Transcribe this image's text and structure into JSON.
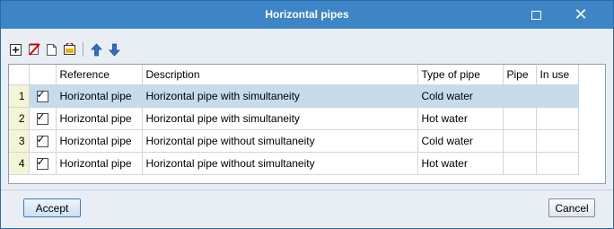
{
  "window": {
    "title": "Horizontal pipes",
    "maximize_icon": "maximize-icon",
    "close_icon": "close-icon",
    "titlebar_color": "#3d85c6"
  },
  "toolbar": {
    "icons": [
      "add-row-icon",
      "delete-row-icon",
      "copy-row-icon",
      "edit-icon",
      "move-up-icon",
      "move-down-icon"
    ]
  },
  "table": {
    "columns": [
      "",
      "",
      "Reference",
      "Description",
      "Type of pipe",
      "Pipe",
      "In use"
    ],
    "rows": [
      {
        "num": "1",
        "checked": true,
        "reference": "Horizontal pipe",
        "description": "Horizontal pipe with simultaneity",
        "type": "Cold water",
        "pipe": "",
        "in_use": ""
      },
      {
        "num": "2",
        "checked": true,
        "reference": "Horizontal pipe",
        "description": "Horizontal pipe with simultaneity",
        "type": "Hot water",
        "pipe": "",
        "in_use": ""
      },
      {
        "num": "3",
        "checked": true,
        "reference": "Horizontal pipe",
        "description": "Horizontal pipe without simultaneity",
        "type": "Cold water",
        "pipe": "",
        "in_use": ""
      },
      {
        "num": "4",
        "checked": true,
        "reference": "Horizontal pipe",
        "description": "Horizontal pipe without simultaneity",
        "type": "Hot water",
        "pipe": "",
        "in_use": ""
      }
    ],
    "selected_row": "1",
    "selection_color": "#c6dcec"
  },
  "buttons": {
    "accept": "Accept",
    "cancel": "Cancel"
  }
}
